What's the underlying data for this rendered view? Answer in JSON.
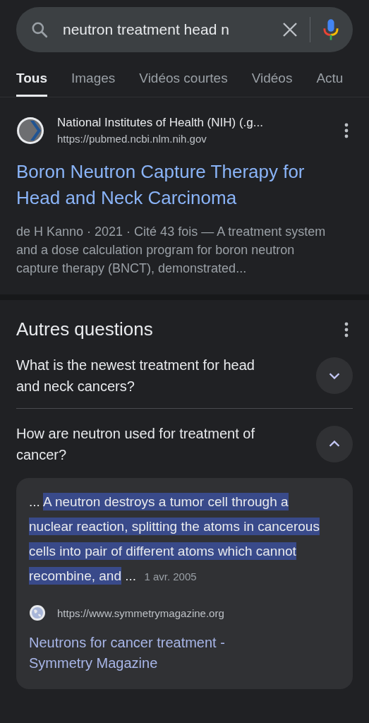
{
  "search": {
    "value": "neutron treatment head n"
  },
  "tabs": [
    {
      "label": "Tous",
      "selected": true
    },
    {
      "label": "Images",
      "selected": false
    },
    {
      "label": "Vidéos courtes",
      "selected": false
    },
    {
      "label": "Vidéos",
      "selected": false
    },
    {
      "label": "Actu",
      "selected": false
    }
  ],
  "result": {
    "site": "National Institutes of Health (NIH) (.g...",
    "url": "https://pubmed.ncbi.nlm.nih.gov",
    "title": "Boron Neutron Capture Therapy for Head and Neck Carcinoma",
    "snippet": "de H Kanno · 2021 · Cité 43 fois — A treatment system and a dose calculation program for boron neutron capture therapy (BNCT), demonstrated..."
  },
  "questions_section": {
    "title": "Autres questions",
    "items": [
      {
        "question": "What is the newest treatment for head and neck cancers?",
        "expanded": false
      },
      {
        "question": "How are neutron used for treatment of cancer?",
        "expanded": true,
        "answer": {
          "lead": "...",
          "highlight": "A neutron destroys a tumor cell through a nuclear reaction, splitting the atoms in cancerous cells into pair of different atoms which cannot recombine, and",
          "trail": "...",
          "date": "1 avr. 2005",
          "url": "https://www.symmetrymagazine.org",
          "link": "Neutrons for cancer treatment - Symmetry Magazine"
        }
      }
    ]
  }
}
